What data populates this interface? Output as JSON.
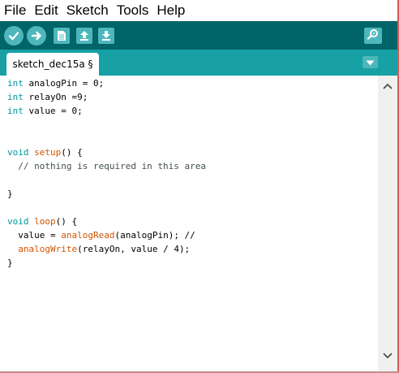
{
  "menu": {
    "file": "File",
    "edit": "Edit",
    "sketch": "Sketch",
    "tools": "Tools",
    "help": "Help"
  },
  "toolbar": {
    "buttons": [
      "verify-icon",
      "upload-icon",
      "new-file-icon",
      "open-icon",
      "save-icon"
    ],
    "serial_monitor_icon": "magnifier-icon"
  },
  "tabs": [
    {
      "label": "sketch_dec15a §"
    }
  ],
  "colors": {
    "toolbar_bg": "#006468",
    "tabstrip_bg": "#17a1a5",
    "button_bg": "#4db7bb",
    "keyword": "#00979c",
    "function": "#d35400"
  },
  "code": {
    "l1": {
      "kw": "int",
      "rest": " analogPin = 0;"
    },
    "l2": {
      "kw": "int",
      "rest": " relayOn =9;"
    },
    "l3": {
      "kw": "int",
      "rest": " value = 0;"
    },
    "l6": {
      "kw": "void",
      "mid": " ",
      "fn": "setup",
      "rest": "() {"
    },
    "l7": {
      "text": "  // nothing is required in this area"
    },
    "l9": {
      "text": "}"
    },
    "l11": {
      "kw": "void",
      "mid": " ",
      "fn": "loop",
      "rest": "() {"
    },
    "l12": {
      "pre": "  value = ",
      "fn": "analogRead",
      "rest": "(analogPin); //"
    },
    "l13": {
      "pre": "  ",
      "fn": "analogWrite",
      "rest": "(relayOn, value / 4);"
    },
    "l14": {
      "text": "}"
    }
  }
}
